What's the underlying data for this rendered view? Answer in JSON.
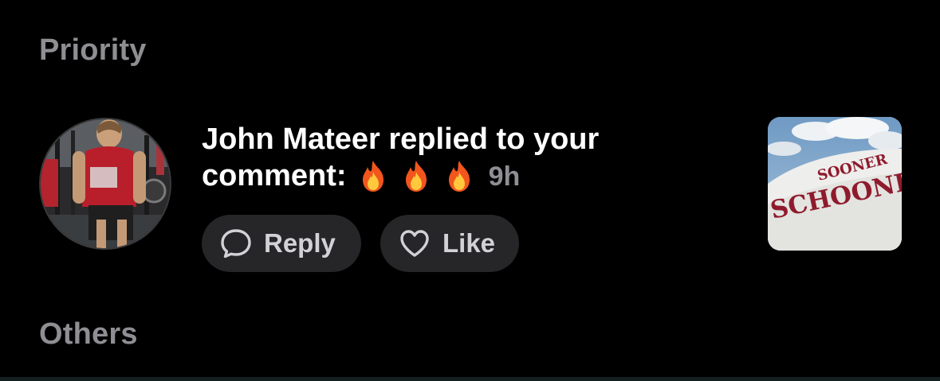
{
  "sections": {
    "priority": "Priority",
    "others": "Others"
  },
  "notification": {
    "author": "John Mateer",
    "message_line1": "John Mateer replied to your",
    "message_line2": "comment:",
    "emojis": [
      "fire-emoji",
      "fire-emoji",
      "fire-emoji"
    ],
    "time": "9h",
    "avatar_icon": "user-avatar",
    "thumbnail": {
      "icon": "post-thumbnail",
      "text_small": "SOONER",
      "text_large": "SCHOONER"
    }
  },
  "actions": {
    "reply_label": "Reply",
    "reply_icon": "comment-bubble-icon",
    "like_label": "Like",
    "like_icon": "heart-outline-icon"
  },
  "colors": {
    "background": "#000000",
    "section_header": "#8e8e93",
    "button_bg": "#262628",
    "button_text": "#d1d1d6",
    "time_text": "#8e8e93",
    "thumb_logo": "#8e1b2c"
  }
}
